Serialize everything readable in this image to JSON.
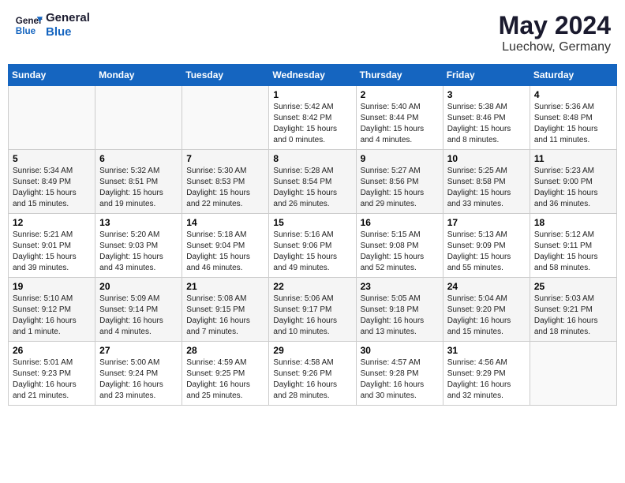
{
  "header": {
    "logo_line1": "General",
    "logo_line2": "Blue",
    "month": "May 2024",
    "location": "Luechow, Germany"
  },
  "weekdays": [
    "Sunday",
    "Monday",
    "Tuesday",
    "Wednesday",
    "Thursday",
    "Friday",
    "Saturday"
  ],
  "weeks": [
    [
      {
        "day": "",
        "info": ""
      },
      {
        "day": "",
        "info": ""
      },
      {
        "day": "",
        "info": ""
      },
      {
        "day": "1",
        "info": "Sunrise: 5:42 AM\nSunset: 8:42 PM\nDaylight: 15 hours\nand 0 minutes."
      },
      {
        "day": "2",
        "info": "Sunrise: 5:40 AM\nSunset: 8:44 PM\nDaylight: 15 hours\nand 4 minutes."
      },
      {
        "day": "3",
        "info": "Sunrise: 5:38 AM\nSunset: 8:46 PM\nDaylight: 15 hours\nand 8 minutes."
      },
      {
        "day": "4",
        "info": "Sunrise: 5:36 AM\nSunset: 8:48 PM\nDaylight: 15 hours\nand 11 minutes."
      }
    ],
    [
      {
        "day": "5",
        "info": "Sunrise: 5:34 AM\nSunset: 8:49 PM\nDaylight: 15 hours\nand 15 minutes."
      },
      {
        "day": "6",
        "info": "Sunrise: 5:32 AM\nSunset: 8:51 PM\nDaylight: 15 hours\nand 19 minutes."
      },
      {
        "day": "7",
        "info": "Sunrise: 5:30 AM\nSunset: 8:53 PM\nDaylight: 15 hours\nand 22 minutes."
      },
      {
        "day": "8",
        "info": "Sunrise: 5:28 AM\nSunset: 8:54 PM\nDaylight: 15 hours\nand 26 minutes."
      },
      {
        "day": "9",
        "info": "Sunrise: 5:27 AM\nSunset: 8:56 PM\nDaylight: 15 hours\nand 29 minutes."
      },
      {
        "day": "10",
        "info": "Sunrise: 5:25 AM\nSunset: 8:58 PM\nDaylight: 15 hours\nand 33 minutes."
      },
      {
        "day": "11",
        "info": "Sunrise: 5:23 AM\nSunset: 9:00 PM\nDaylight: 15 hours\nand 36 minutes."
      }
    ],
    [
      {
        "day": "12",
        "info": "Sunrise: 5:21 AM\nSunset: 9:01 PM\nDaylight: 15 hours\nand 39 minutes."
      },
      {
        "day": "13",
        "info": "Sunrise: 5:20 AM\nSunset: 9:03 PM\nDaylight: 15 hours\nand 43 minutes."
      },
      {
        "day": "14",
        "info": "Sunrise: 5:18 AM\nSunset: 9:04 PM\nDaylight: 15 hours\nand 46 minutes."
      },
      {
        "day": "15",
        "info": "Sunrise: 5:16 AM\nSunset: 9:06 PM\nDaylight: 15 hours\nand 49 minutes."
      },
      {
        "day": "16",
        "info": "Sunrise: 5:15 AM\nSunset: 9:08 PM\nDaylight: 15 hours\nand 52 minutes."
      },
      {
        "day": "17",
        "info": "Sunrise: 5:13 AM\nSunset: 9:09 PM\nDaylight: 15 hours\nand 55 minutes."
      },
      {
        "day": "18",
        "info": "Sunrise: 5:12 AM\nSunset: 9:11 PM\nDaylight: 15 hours\nand 58 minutes."
      }
    ],
    [
      {
        "day": "19",
        "info": "Sunrise: 5:10 AM\nSunset: 9:12 PM\nDaylight: 16 hours\nand 1 minute."
      },
      {
        "day": "20",
        "info": "Sunrise: 5:09 AM\nSunset: 9:14 PM\nDaylight: 16 hours\nand 4 minutes."
      },
      {
        "day": "21",
        "info": "Sunrise: 5:08 AM\nSunset: 9:15 PM\nDaylight: 16 hours\nand 7 minutes."
      },
      {
        "day": "22",
        "info": "Sunrise: 5:06 AM\nSunset: 9:17 PM\nDaylight: 16 hours\nand 10 minutes."
      },
      {
        "day": "23",
        "info": "Sunrise: 5:05 AM\nSunset: 9:18 PM\nDaylight: 16 hours\nand 13 minutes."
      },
      {
        "day": "24",
        "info": "Sunrise: 5:04 AM\nSunset: 9:20 PM\nDaylight: 16 hours\nand 15 minutes."
      },
      {
        "day": "25",
        "info": "Sunrise: 5:03 AM\nSunset: 9:21 PM\nDaylight: 16 hours\nand 18 minutes."
      }
    ],
    [
      {
        "day": "26",
        "info": "Sunrise: 5:01 AM\nSunset: 9:23 PM\nDaylight: 16 hours\nand 21 minutes."
      },
      {
        "day": "27",
        "info": "Sunrise: 5:00 AM\nSunset: 9:24 PM\nDaylight: 16 hours\nand 23 minutes."
      },
      {
        "day": "28",
        "info": "Sunrise: 4:59 AM\nSunset: 9:25 PM\nDaylight: 16 hours\nand 25 minutes."
      },
      {
        "day": "29",
        "info": "Sunrise: 4:58 AM\nSunset: 9:26 PM\nDaylight: 16 hours\nand 28 minutes."
      },
      {
        "day": "30",
        "info": "Sunrise: 4:57 AM\nSunset: 9:28 PM\nDaylight: 16 hours\nand 30 minutes."
      },
      {
        "day": "31",
        "info": "Sunrise: 4:56 AM\nSunset: 9:29 PM\nDaylight: 16 hours\nand 32 minutes."
      },
      {
        "day": "",
        "info": ""
      }
    ]
  ]
}
